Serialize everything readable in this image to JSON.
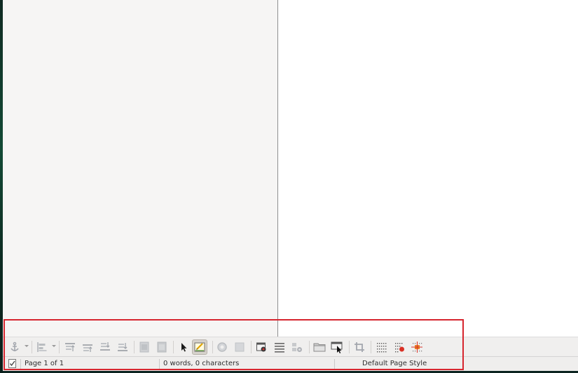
{
  "statusbar": {
    "page": "Page 1 of 1",
    "word_count": "0 words, 0 characters",
    "page_style": "Default Page Style"
  },
  "toolbar": {
    "icons": [
      "anchor-icon",
      "align-objects-icon",
      "bring-to-front-icon",
      "forward-one-icon",
      "backward-one-icon",
      "send-to-back-icon",
      "to-foreground-icon",
      "to-background-icon",
      "select-pointer-icon",
      "design-mode-icon",
      "control-properties-icon",
      "form-properties-icon",
      "form-navigator-icon",
      "activation-order-icon",
      "add-field-icon",
      "open-in-design-mode-icon",
      "automatic-control-focus-icon",
      "crop-icon",
      "display-grid-icon",
      "snap-to-grid-icon",
      "helplines-while-moving-icon"
    ]
  },
  "colors": {
    "highlight_border": "#d6252e",
    "active_icon_bg": "#d6d2cc",
    "page_background": "#ffffff",
    "sidebar_background": "#f6f5f4"
  }
}
